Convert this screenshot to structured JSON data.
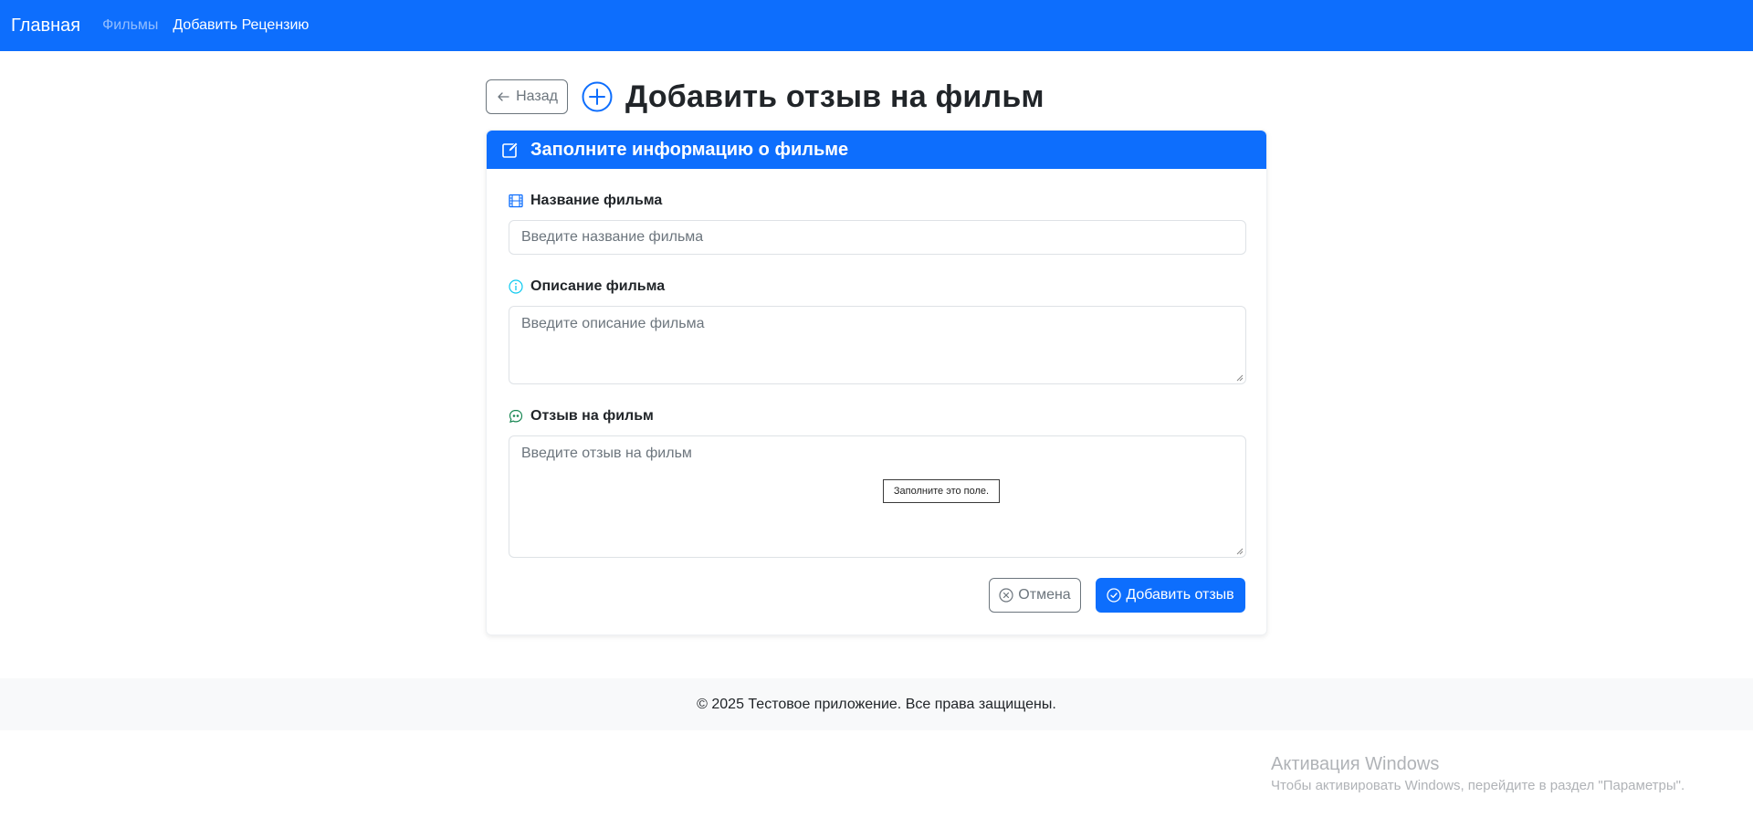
{
  "nav": {
    "brand": "Главная",
    "links": [
      "Фильмы",
      "Добавить Рецензию"
    ]
  },
  "header": {
    "back_label": "Назад",
    "title": "Добавить отзыв на фильм"
  },
  "card": {
    "title": "Заполните информацию о фильме",
    "fields": [
      {
        "label": "Название фильма",
        "placeholder": "Введите название фильма",
        "icon": "film-icon"
      },
      {
        "label": "Описание фильма",
        "placeholder": "Введите описание фильма",
        "icon": "info-icon"
      },
      {
        "label": "Отзыв на фильм",
        "placeholder": "Введите отзыв на фильм",
        "icon": "chat-quote-icon"
      }
    ],
    "tooltip": "Заполните это поле.",
    "cancel_label": "Отмена",
    "submit_label": "Добавить отзыв"
  },
  "footer": {
    "text": "© 2025 Тестовое приложение. Все права защищены."
  },
  "watermark": {
    "title": "Активация Windows",
    "subtitle": "Чтобы активировать Windows, перейдите в раздел \"Параметры\"."
  },
  "colors": {
    "primary": "#0d6efd",
    "secondary": "#6c757d",
    "info": "#0dcaf0",
    "success": "#198754",
    "footer_bg": "#f8f9fa"
  }
}
